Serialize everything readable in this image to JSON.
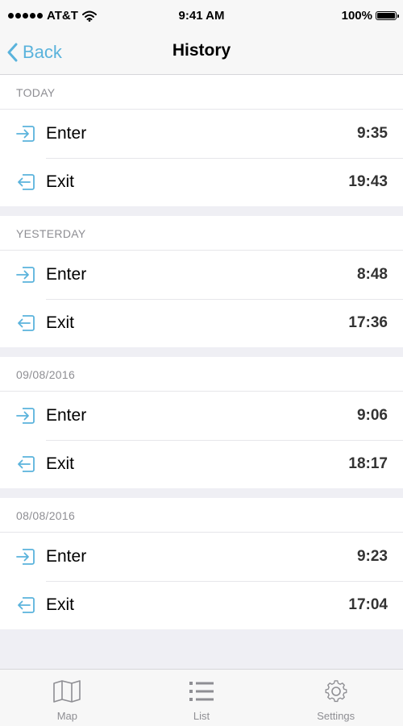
{
  "status_bar": {
    "carrier": "AT&T",
    "time": "9:41 AM",
    "battery": "100%",
    "battery_level": 1.0
  },
  "nav": {
    "back_label": "Back",
    "title": "History"
  },
  "colors": {
    "accent": "#5ab3dc",
    "background": "#efeff4",
    "header_text": "#8e8e93"
  },
  "sections": [
    {
      "header": "TODAY",
      "rows": [
        {
          "type": "enter",
          "icon": "enter-icon",
          "label": "Enter",
          "time": "9:35"
        },
        {
          "type": "exit",
          "icon": "exit-icon",
          "label": "Exit",
          "time": "19:43"
        }
      ]
    },
    {
      "header": "YESTERDAY",
      "rows": [
        {
          "type": "enter",
          "icon": "enter-icon",
          "label": "Enter",
          "time": "8:48"
        },
        {
          "type": "exit",
          "icon": "exit-icon",
          "label": "Exit",
          "time": "17:36"
        }
      ]
    },
    {
      "header": "09/08/2016",
      "rows": [
        {
          "type": "enter",
          "icon": "enter-icon",
          "label": "Enter",
          "time": "9:06"
        },
        {
          "type": "exit",
          "icon": "exit-icon",
          "label": "Exit",
          "time": "18:17"
        }
      ]
    },
    {
      "header": "08/08/2016",
      "rows": [
        {
          "type": "enter",
          "icon": "enter-icon",
          "label": "Enter",
          "time": "9:23"
        },
        {
          "type": "exit",
          "icon": "exit-icon",
          "label": "Exit",
          "time": "17:04"
        }
      ]
    }
  ],
  "tab_bar": {
    "tabs": [
      {
        "label": "Map",
        "icon": "map-icon"
      },
      {
        "label": "List",
        "icon": "list-icon"
      },
      {
        "label": "Settings",
        "icon": "gear-icon"
      }
    ]
  }
}
